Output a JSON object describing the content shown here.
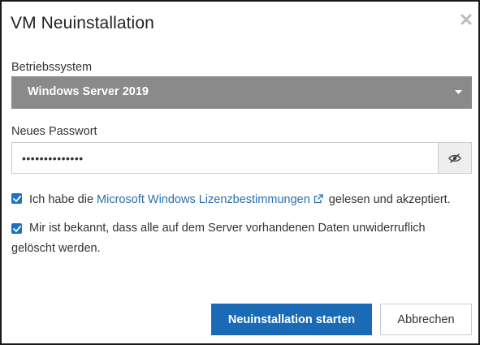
{
  "dialog": {
    "title": "VM Neuinstallation",
    "close_icon": "close-icon"
  },
  "os": {
    "label": "Betriebssystem",
    "selected": "Windows Server 2019",
    "caret_icon": "caret-down-icon"
  },
  "password": {
    "label": "Neues Passwort",
    "value": "••••••••••••••",
    "toggle_icon": "eye-slash-icon"
  },
  "checks": {
    "license": {
      "checked": true,
      "prefix": "Ich habe die ",
      "link": "Microsoft Windows Lizenzbestimmungen",
      "link_icon": "external-link-icon",
      "suffix": " gelesen und akzeptiert."
    },
    "data_loss": {
      "checked": true,
      "line1": "Mir ist bekannt, dass alle auf dem Server vorhandenen Daten unwiderruflich",
      "line2": "gelöscht werden."
    }
  },
  "buttons": {
    "start": "Neuinstallation starten",
    "cancel": "Abbrechen"
  },
  "colors": {
    "primary": "#1a6ab6",
    "select_bg": "#8a8a8a",
    "checkbox": "#1a73c8",
    "link": "#2a6fb0"
  }
}
